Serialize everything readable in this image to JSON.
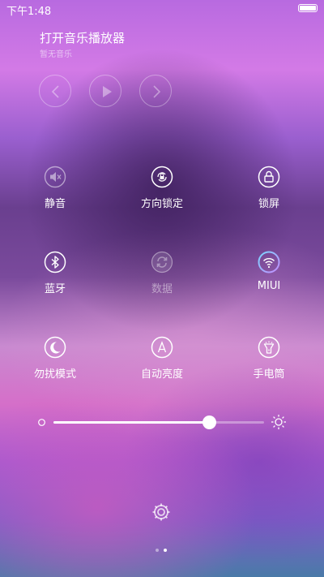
{
  "status_bar": {
    "time": "下午1:48"
  },
  "music": {
    "title": "打开音乐播放器",
    "subtitle": "暂无音乐",
    "controls": [
      "previous-icon",
      "play-icon",
      "next-icon"
    ]
  },
  "toggles": [
    {
      "label": "静音",
      "icon": "mute-icon"
    },
    {
      "label": "方向锁定",
      "icon": "rotation-lock-icon"
    },
    {
      "label": "锁屏",
      "icon": "lock-icon"
    },
    {
      "label": "蓝牙",
      "icon": "bluetooth-icon"
    },
    {
      "label": "数据",
      "icon": "data-sync-icon"
    },
    {
      "label": "MIUI",
      "icon": "wifi-icon"
    },
    {
      "label": "勿扰模式",
      "icon": "moon-icon"
    },
    {
      "label": "自动亮度",
      "icon": "auto-brightness-icon"
    },
    {
      "label": "手电筒",
      "icon": "flashlight-icon"
    }
  ],
  "brightness": {
    "level": 0.74
  },
  "pager": {
    "pages": 2,
    "current": 2
  },
  "colors": {
    "accent": "#ffffff",
    "wifi_ring_a": "#7ad7ff",
    "wifi_ring_b": "#c48cff"
  }
}
